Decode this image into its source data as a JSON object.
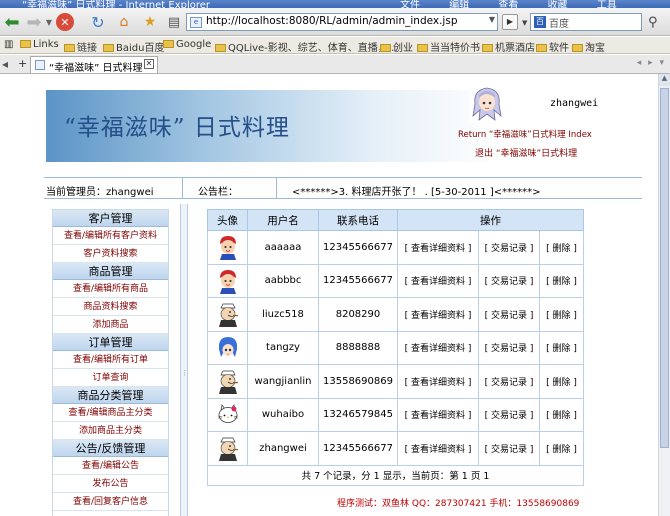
{
  "window": {
    "title": "“幸福滋味” 日式料理 - Internet Explorer",
    "menu": [
      "文件",
      "编辑",
      "查看",
      "收藏",
      "工具"
    ]
  },
  "toolbar": {
    "address": "http://localhost:8080/RL/admin/admin_index.jsp",
    "search_placeholder": "百度"
  },
  "links_bar": {
    "items": [
      "Links",
      "链接",
      "Baidu百度",
      "Google",
      "QQLive-影视、综艺、体育、直播，…",
      "创业",
      "当当特价书",
      "机票酒店",
      "软件",
      "淘宝"
    ]
  },
  "tab": {
    "title": "“幸福滋味” 日式料理"
  },
  "header": {
    "title": "“幸福滋味” 日式料理",
    "username": "zhangwei",
    "return_link": "Return “幸福滋味”日式料理 Index",
    "logout_link": "退出 “幸福滋味”日式料理"
  },
  "info": {
    "current_admin": "当前管理员：zhangwei",
    "notice_label": "公告栏：",
    "notice_text": "<******>3. 料理店开张了！ . [5-30-2011 ]<******>"
  },
  "sidebar": {
    "groups": [
      {
        "title": "客户管理",
        "items": [
          "查看/编辑所有客户资料",
          "客户资料搜索"
        ]
      },
      {
        "title": "商品管理",
        "items": [
          "查看/编辑所有商品",
          "商品资料搜索",
          "添加商品"
        ]
      },
      {
        "title": "订单管理",
        "items": [
          "查看/编辑所有订单",
          "订单查询"
        ]
      },
      {
        "title": "商品分类管理",
        "items": [
          "查看/编辑商品主分类",
          "添加商品主分类"
        ]
      },
      {
        "title": "公告/反馈管理",
        "items": [
          "查看/编辑公告",
          "发布公告",
          "查看/回复客户信息"
        ]
      }
    ]
  },
  "table": {
    "headers": {
      "avatar": "头像",
      "username": "用户名",
      "phone": "联系电话",
      "actions": "操作"
    },
    "actions": {
      "detail": "[ 查看详细资料 ]",
      "trades": "[ 交易记录 ]",
      "delete": "[ 删除 ]"
    },
    "rows": [
      {
        "avatar": "kid-red",
        "username": "aaaaaa",
        "phone": "12345566677"
      },
      {
        "avatar": "kid-red",
        "username": "aabbbc",
        "phone": "12345566677"
      },
      {
        "avatar": "popeye",
        "username": "liuzc518",
        "phone": "8208290"
      },
      {
        "avatar": "anime-blue",
        "username": "tangzy",
        "phone": "8888888"
      },
      {
        "avatar": "popeye",
        "username": "wangjianlin",
        "phone": "13558690869"
      },
      {
        "avatar": "hello-kitty",
        "username": "wuhaibo",
        "phone": "13246579845"
      },
      {
        "avatar": "popeye",
        "username": "zhangwei",
        "phone": "12345566677"
      }
    ],
    "pager": "共 7 个记录，分 1 显示，当前页：第 1 页    1"
  },
  "footer": {
    "credit": "程序测试：双鱼林  QQ：287307421  手机：13558690869"
  },
  "colors": {
    "link": "#800000",
    "header_bg": "#d2e4f5",
    "footer": "#c00000"
  }
}
